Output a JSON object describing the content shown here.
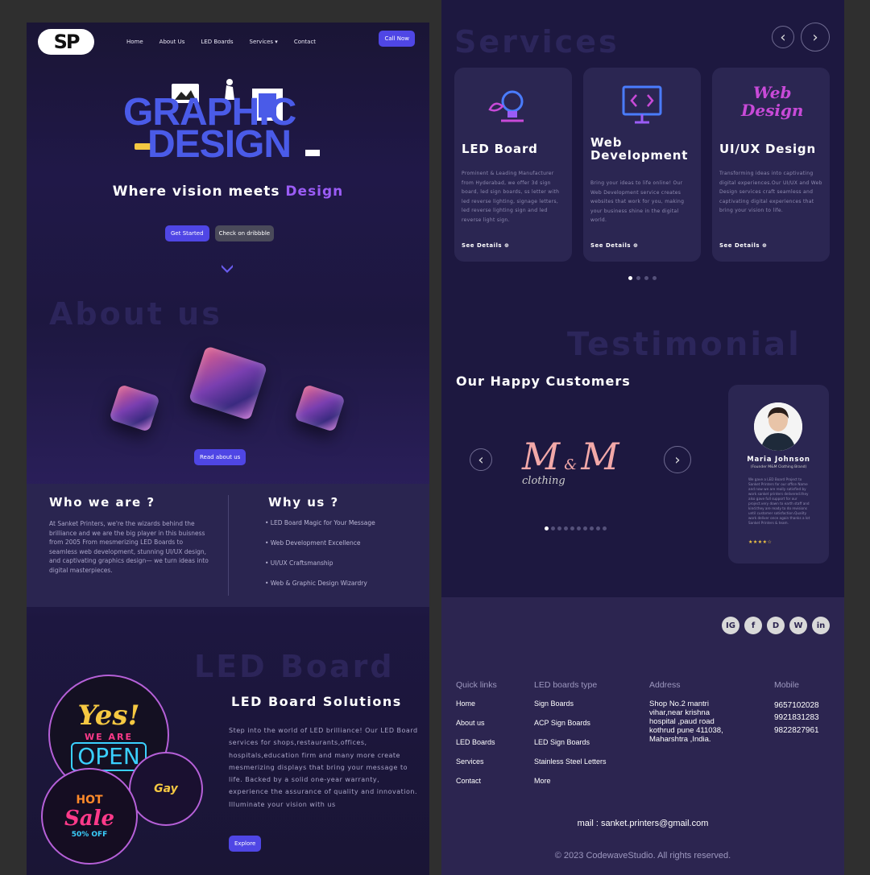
{
  "nav": {
    "logo": "SP",
    "links": [
      "Home",
      "About Us",
      "LED Boards",
      "Services ▾",
      "Contact"
    ],
    "cta": "Call Now"
  },
  "hero": {
    "art_line1": "GRAPHIC",
    "art_line2": "DESIGN",
    "tagline_prefix": "Where vision meets ",
    "tagline_accent": "Design",
    "btn_start": "Get Started",
    "btn_dribbble": "Check on dribbble"
  },
  "about": {
    "bg_word": "About us",
    "read_btn": "Read about us",
    "who_title": "Who we are ?",
    "who_text": "At Sanket Printers, we're the wizards behind the brilliance and we are the big player in this buisness from 2005 From mesmerizing LED Boards to seamless web development, stunning UI/UX design, and captivating graphics design— we turn ideas into digital masterpieces.",
    "why_title": "Why us ?",
    "why_items": [
      "• LED Board Magic for Your Message",
      "• Web Development Excellence",
      "• UI/UX Craftsmanship",
      "• Web & Graphic Design Wizardry"
    ]
  },
  "led": {
    "bg_word": "LED Board",
    "title": "LED Board Solutions",
    "text": "Step into the world of LED brilliance! Our LED Board services for shops,restaurants,offices, hospitals,education firm and many more create mesmerizing displays that bring your message to life. Backed by a solid one-year warranty, experience the assurance of quality and innovation. Illuminate your vision with us",
    "btn": "Explore",
    "neon1_a": "Yes!",
    "neon1_b": "WE ARE",
    "neon1_c": "OPEN",
    "neon2_a": "HOT",
    "neon2_b": "Sale",
    "neon2_c": "50% OFF",
    "neon3": "Gay"
  },
  "services": {
    "bg_word": "Services",
    "cards": [
      {
        "title": "LED Board",
        "desc": "Prominent & Leading Manufacturer from Hyderabad, we offer 3d sign board, led sign boards, ss letter with led reverse lighting, signage letters, led reverse lighting sign and led reverse light sign.",
        "link": "See Details"
      },
      {
        "title": "Web Development",
        "desc": "Bring your ideas to life online! Our Web Development service creates websites that work for you, making your business shine in the digital world.",
        "link": "See Details"
      },
      {
        "title": "UI/UX Design",
        "desc": "Transforming ideas into captivating digital experiences.Our UI/UX and Web Design services craft seamless and captivating digital experiences that bring your vision to life.",
        "link": "See Details"
      }
    ],
    "web_icon_text": "Web",
    "design_icon_text": "Design"
  },
  "testimonial": {
    "bg_word": "Testimonial",
    "heading": "Our Happy Customers",
    "brand_m1": "M",
    "brand_amp": "&",
    "brand_m2": "M",
    "brand_sub": "clothing",
    "reviewer": "Maria Johnson",
    "role": "(Founder M&M Clothing Brand)",
    "review": "We gave a LED Board Project to Sanket Printers for our office Name and now we are really satisfied by work sanket printers delivered.they also gave full support for our project.very down to earth staff and kind.they are ready to do revisions until customer satisfaction.Quality work deliver once again thanks a lot Sanket Printers & team.",
    "stars": "★★★★☆"
  },
  "footer": {
    "social": [
      "IG",
      "f",
      "D",
      "W",
      "in"
    ],
    "quick_head": "Quick links",
    "quick": [
      "Home",
      "About us",
      "LED Boards",
      "Services",
      "Contact"
    ],
    "types_head": "LED boards type",
    "types": [
      "Sign Boards",
      "ACP Sign Boards",
      "LED Sign Boards",
      "Stainless Steel Letters",
      "More"
    ],
    "addr_head": "Address",
    "address": "Shop No.2 mantri vihar,near krishna hospital ,paud road kothrud pune 411038, Maharshtra ,India.",
    "mob_head": "Mobile",
    "mobiles": [
      "9657102028",
      "9921831283",
      "9822827961"
    ],
    "mail": "mail : sanket.printers@gmail.com",
    "copyright": "© 2023 CodewaveStudio. All rights reserved."
  },
  "colors": {
    "accent": "#4f46e5",
    "purple": "#9b5cf6",
    "bg_dark": "#1d1840"
  }
}
